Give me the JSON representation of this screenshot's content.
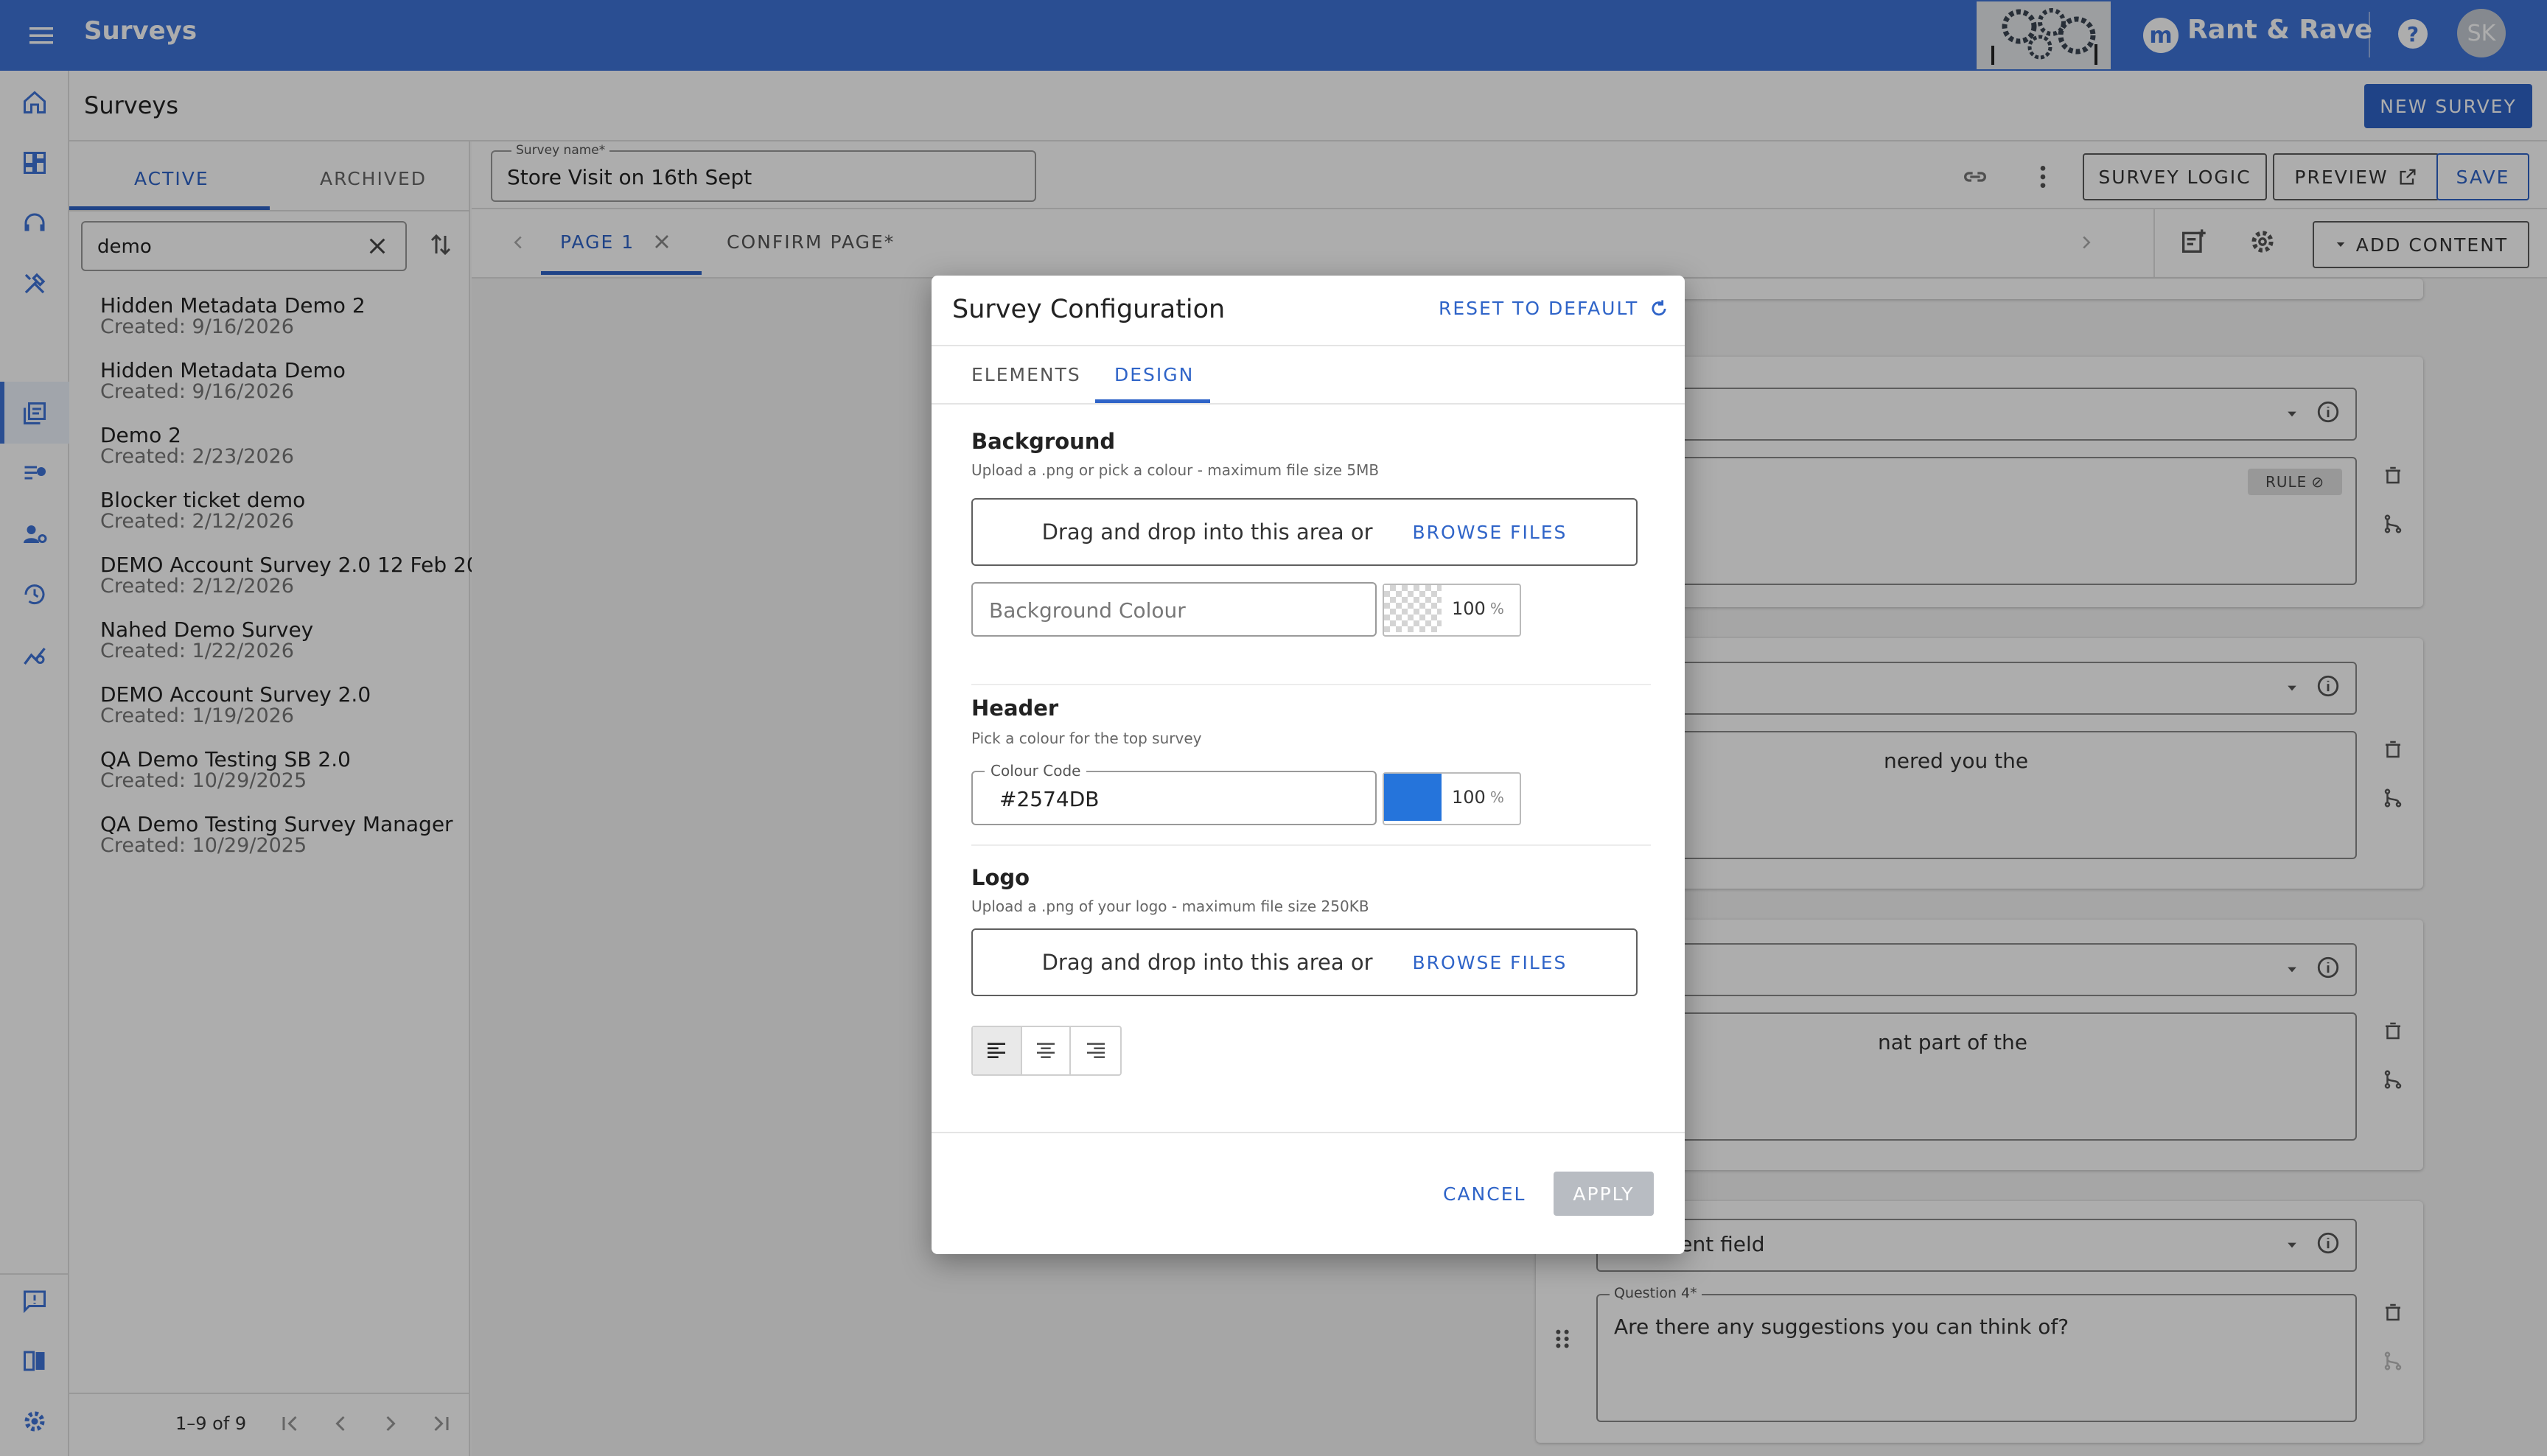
{
  "colors": {
    "primary": "#3f73d8",
    "header_colour": "#2574DB"
  },
  "topbar": {
    "app_title": "Surveys",
    "brand": "Rant & Rave",
    "avatar_initials": "SK",
    "help_icon": "help-icon",
    "menu_icon": "menu-icon"
  },
  "page": {
    "title": "Surveys",
    "new_button": "NEW SURVEY"
  },
  "sidebar_nav": [
    "home-icon",
    "dashboard-icon",
    "headset-icon",
    "tools-icon",
    "surveys-icon",
    "review-icon",
    "users-icon",
    "history-icon",
    "analytics-icon",
    "feedback-icon",
    "swap-icon",
    "settings-icon"
  ],
  "panel": {
    "tabs": [
      "ACTIVE",
      "ARCHIVED"
    ],
    "search_value": "demo",
    "surveys": [
      {
        "name": "Hidden Metadata Demo 2",
        "created": "Created: 9/16/2026"
      },
      {
        "name": "Hidden Metadata Demo",
        "created": "Created: 9/16/2026"
      },
      {
        "name": "Demo 2",
        "created": "Created: 2/23/2026"
      },
      {
        "name": "Blocker ticket demo",
        "created": "Created: 2/12/2026"
      },
      {
        "name": "DEMO Account Survey 2.0 12 Feb 20...",
        "created": "Created: 2/12/2026"
      },
      {
        "name": "Nahed Demo Survey",
        "created": "Created: 1/22/2026"
      },
      {
        "name": "DEMO Account Survey 2.0",
        "created": "Created: 1/19/2026"
      },
      {
        "name": "QA Demo Testing SB 2.0",
        "created": "Created: 10/29/2025"
      },
      {
        "name": "QA Demo Testing Survey Manager",
        "created": "Created: 10/29/2025"
      }
    ],
    "pagination": "1–9 of 9"
  },
  "editor": {
    "survey_name_label": "Survey name*",
    "survey_name": "Store Visit on 16th Sept",
    "buttons": {
      "logic": "SURVEY LOGIC",
      "preview": "PREVIEW",
      "save": "SAVE",
      "add_content": "ADD CONTENT"
    },
    "page_tabs": [
      "PAGE 1",
      "CONFIRM PAGE*"
    ],
    "rule_badge": "RULE",
    "snippets": [
      "nered you the",
      "nat part of the"
    ],
    "q4_type": "Comment field",
    "q4_label": "Question 4*",
    "q4_text": "Are there any suggestions you can think of?"
  },
  "dialog": {
    "title": "Survey Configuration",
    "reset": "RESET TO DEFAULT",
    "tabs": [
      "ELEMENTS",
      "DESIGN"
    ],
    "background": {
      "title": "Background",
      "subtitle": "Upload a .png or pick a colour - maximum file size 5MB",
      "drop_text": "Drag and drop into this area or",
      "browse": "BROWSE FILES",
      "colour_placeholder": "Background Colour",
      "opacity": "100",
      "pct": "%"
    },
    "header": {
      "title": "Header",
      "subtitle": "Pick a colour for the top survey",
      "colour_label": "Colour Code",
      "colour_value": "#2574DB",
      "opacity": "100",
      "pct": "%"
    },
    "logo": {
      "title": "Logo",
      "subtitle": "Upload a .png of your logo - maximum file size 250KB",
      "drop_text": "Drag and drop into this area or",
      "browse": "BROWSE FILES",
      "alignment": [
        "align-left-icon",
        "align-center-icon",
        "align-right-icon"
      ]
    },
    "cancel": "CANCEL",
    "apply": "APPLY"
  }
}
